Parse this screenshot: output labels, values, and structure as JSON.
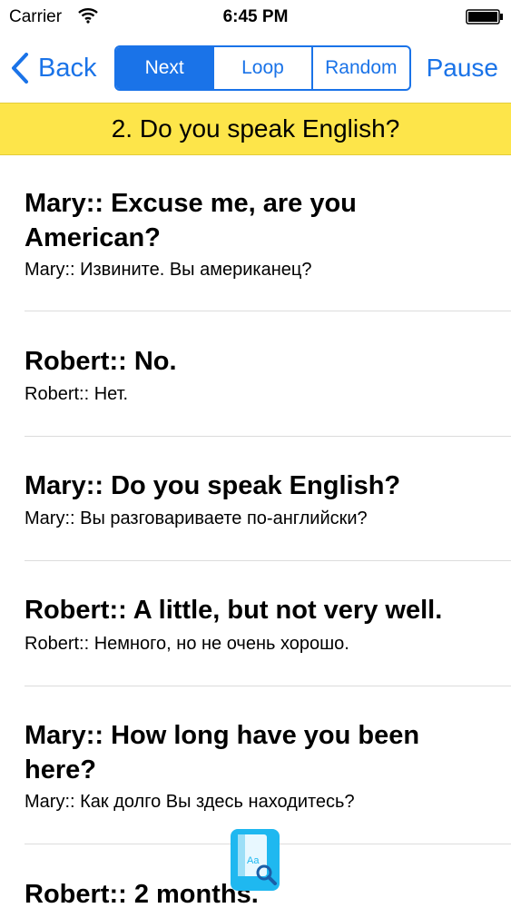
{
  "status_bar": {
    "carrier": "Carrier",
    "time": "6:45 PM",
    "wifi_icon": "wifi-icon",
    "battery_icon": "battery-icon"
  },
  "nav": {
    "back_label": "Back",
    "back_icon": "chevron-left-icon",
    "segments": [
      "Next",
      "Loop",
      "Random"
    ],
    "selected_segment": "Next",
    "pause_label": "Pause",
    "accent_color": "#1a73e8"
  },
  "lesson": {
    "title": "2. Do you speak English?",
    "banner_color": "#fde54a"
  },
  "phrases": [
    {
      "english": "Mary:: Excuse me, are you American?",
      "russian": "Mary:: Извините. Вы американец?"
    },
    {
      "english": "Robert:: No.",
      "russian": "Robert:: Нет."
    },
    {
      "english": "Mary:: Do you speak English?",
      "russian": "Mary:: Вы разговариваете по-английски?"
    },
    {
      "english": "Robert:: A little, but not very well.",
      "russian": "Robert:: Немного, но не очень хорошо."
    },
    {
      "english": "Mary:: How long have you been here?",
      "russian": "Mary:: Как долго Вы здесь находитесь?"
    },
    {
      "english": "Robert:: 2 months.",
      "russian": ""
    }
  ],
  "dictionary_button": {
    "icon": "dictionary-search-icon",
    "label": "Aa",
    "color": "#1fb8f0"
  }
}
